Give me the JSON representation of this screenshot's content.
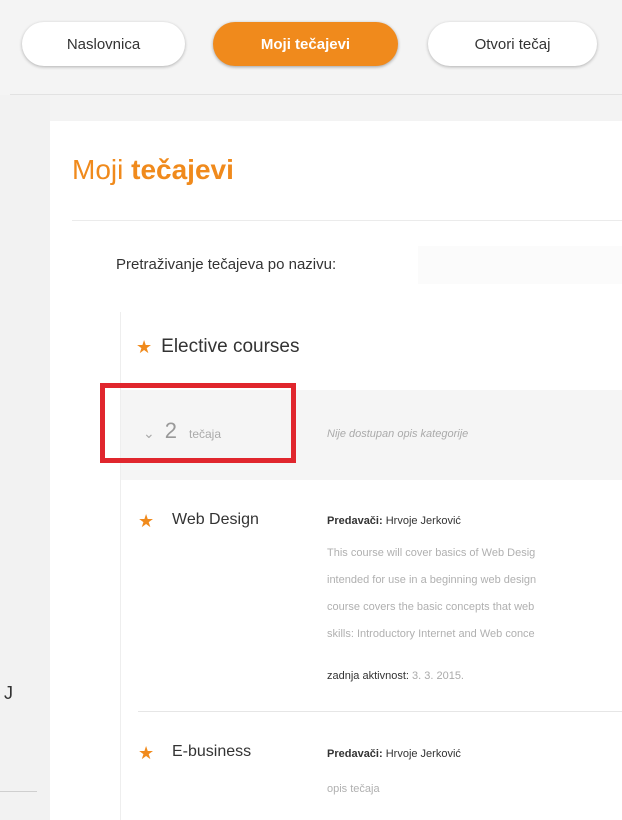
{
  "nav": {
    "tabs": [
      {
        "label": "Naslovnica",
        "active": false
      },
      {
        "label": "Moji tečajevi",
        "active": true
      },
      {
        "label": "Otvori tečaj",
        "active": false
      }
    ]
  },
  "colors": {
    "accent": "#f08a1c",
    "highlight": "#e0262d"
  },
  "left_fragment": "J",
  "page": {
    "title_light": "Moji",
    "title_bold": "tečajevi",
    "search_label": "Pretraživanje tečajeva po nazivu:",
    "search_value": ""
  },
  "category": {
    "name": "Elective courses",
    "count": "2",
    "count_unit": "tečaja",
    "description": "Nije dostupan opis kategorije"
  },
  "courses": [
    {
      "name": "Web Design",
      "lecturers_label": "Predavači:",
      "lecturers": "Hrvoje Jerković",
      "description_lines": [
        "This course will cover basics of Web Desig",
        "intended for use in a beginning web design",
        "course covers the basic concepts that web",
        "skills:  Introductory Internet and Web conce"
      ],
      "activity_label": "zadnja aktivnost:",
      "activity_date": "3. 3. 2015."
    },
    {
      "name": "E-business",
      "lecturers_label": "Predavači:",
      "lecturers": "Hrvoje Jerković",
      "description_lines": [
        "opis tečaja"
      ]
    }
  ]
}
